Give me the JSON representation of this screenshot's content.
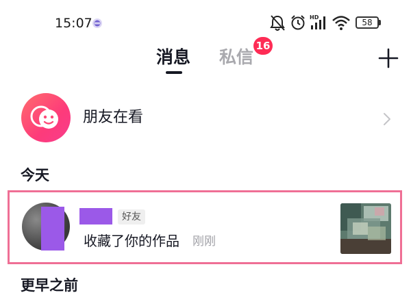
{
  "status_bar": {
    "time": "15:07",
    "battery": "58"
  },
  "tabs": [
    {
      "label": "消息",
      "active": true
    },
    {
      "label": "私信",
      "active": false,
      "badge": "16"
    }
  ],
  "header": {
    "add_icon": "plus-icon"
  },
  "friends_row": {
    "label": "朋友在看",
    "icon": "smile-chat-icon"
  },
  "sections": {
    "today": "今天",
    "earlier": "更早之前"
  },
  "notification": {
    "tag": "好友",
    "text": "收藏了你的作品",
    "time": "刚刚"
  },
  "colors": {
    "accent": "#fe2c55",
    "highlight_border": "#ef6f95",
    "redaction": "#9b59e8"
  }
}
